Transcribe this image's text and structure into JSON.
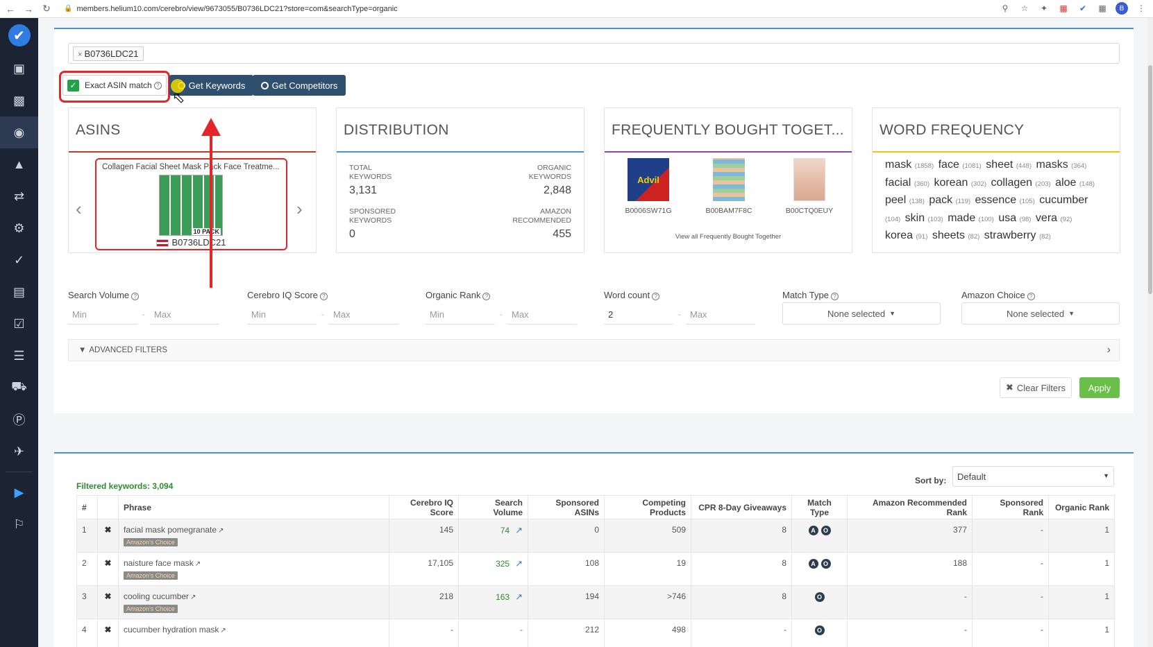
{
  "browser": {
    "url": "members.helium10.com/cerebro/view/9673055/B0736LDC21?store=com&searchType=organic",
    "avatar": "B"
  },
  "sidebar": {
    "icons": [
      "book-icon",
      "chart-icon",
      "globe-icon",
      "area-chart-icon",
      "sync-icon",
      "settings-icon",
      "check-circle-icon",
      "document-icon",
      "checklist-icon",
      "stack-icon",
      "truck-icon",
      "p-icon",
      "plane-icon",
      "play-icon",
      "bell-icon"
    ]
  },
  "search": {
    "asin_tag": "B0736LDC21",
    "exact_label": "Exact ASIN match",
    "get_keywords": "Get Keywords",
    "get_competitors": "Get Competitors"
  },
  "cards": {
    "asins": {
      "title": "ASINS",
      "product_title": "Collagen Facial Sheet Mask Pack Face Treatme...",
      "pack_label": "10 PACK",
      "asin": "B0736LDC21"
    },
    "distribution": {
      "title": "DISTRIBUTION",
      "total_label": "TOTAL\nKEYWORDS",
      "total_value": "3,131",
      "organic_label": "ORGANIC\nKEYWORDS",
      "organic_value": "2,848",
      "sponsored_label": "SPONSORED\nKEYWORDS",
      "sponsored_value": "0",
      "amazon_label": "AMAZON\nRECOMMENDED",
      "amazon_value": "455"
    },
    "fbt": {
      "title": "FREQUENTLY BOUGHT TOGET...",
      "items": [
        {
          "asin": "B0006SW71G",
          "brand": "Advil"
        },
        {
          "asin": "B00BAM7F8C"
        },
        {
          "asin": "B00CTQ0EUY"
        }
      ],
      "view_all": "View all Frequently Bought Together"
    },
    "word_freq": {
      "title": "WORD FREQUENCY",
      "words": [
        {
          "w": "mask",
          "n": "(1858)"
        },
        {
          "w": "face",
          "n": "(1081)"
        },
        {
          "w": "sheet",
          "n": "(448)"
        },
        {
          "w": "masks",
          "n": "(364)"
        },
        {
          "w": "facial",
          "n": "(360)"
        },
        {
          "w": "korean",
          "n": "(302)"
        },
        {
          "w": "collagen",
          "n": "(203)"
        },
        {
          "w": "aloe",
          "n": "(148)"
        },
        {
          "w": "peel",
          "n": "(138)"
        },
        {
          "w": "pack",
          "n": "(119)"
        },
        {
          "w": "essence",
          "n": "(105)"
        },
        {
          "w": "cucumber",
          "n": "(104)"
        },
        {
          "w": "skin",
          "n": "(103)"
        },
        {
          "w": "made",
          "n": "(100)"
        },
        {
          "w": "usa",
          "n": "(98)"
        },
        {
          "w": "vera",
          "n": "(92)"
        },
        {
          "w": "korea",
          "n": "(91)"
        },
        {
          "w": "sheets",
          "n": "(82)"
        },
        {
          "w": "strawberry",
          "n": "(82)"
        }
      ]
    }
  },
  "filters": {
    "search_volume": "Search Volume",
    "cerebro_iq": "Cerebro IQ Score",
    "organic_rank": "Organic Rank",
    "word_count": "Word count",
    "match_type": "Match Type",
    "amazon_choice": "Amazon Choice",
    "min": "Min",
    "max": "Max",
    "word_count_min": "2",
    "none_selected": "None selected",
    "advanced": "ADVANCED FILTERS",
    "clear": "Clear Filters",
    "apply": "Apply"
  },
  "table": {
    "filtered_label": "Filtered keywords: 3,094",
    "sort_label": "Sort by:",
    "sort_value": "Default",
    "headers": [
      "#",
      "",
      "Phrase",
      "Cerebro IQ Score",
      "Search Volume",
      "Sponsored ASINs",
      "Competing Products",
      "CPR 8-Day Giveaways",
      "Match Type",
      "Amazon Recommended Rank",
      "Sponsored Rank",
      "Organic Rank"
    ],
    "amazon_choice_badge": "Amazon's Choice",
    "rows": [
      {
        "n": "1",
        "phrase": "facial mask pomegranate",
        "iq": "145",
        "sv": "74",
        "sponsored": "0",
        "competing": "509",
        "cpr": "8",
        "amazon_rank": "377",
        "sponsored_rank": "-",
        "organic_rank": "1"
      },
      {
        "n": "2",
        "phrase": "naisture face mask",
        "iq": "17,105",
        "sv": "325",
        "sponsored": "108",
        "competing": "19",
        "cpr": "8",
        "amazon_rank": "188",
        "sponsored_rank": "-",
        "organic_rank": "1"
      },
      {
        "n": "3",
        "phrase": "cooling cucumber",
        "iq": "218",
        "sv": "163",
        "sponsored": "194",
        "competing": ">746",
        "cpr": "8",
        "amazon_rank": "-",
        "sponsored_rank": "-",
        "organic_rank": "1"
      },
      {
        "n": "4",
        "phrase": "cucumber hydration mask",
        "iq": "-",
        "sv": "-",
        "sponsored": "212",
        "competing": "498",
        "cpr": "-",
        "amazon_rank": "-",
        "sponsored_rank": "-",
        "organic_rank": "1"
      }
    ]
  }
}
